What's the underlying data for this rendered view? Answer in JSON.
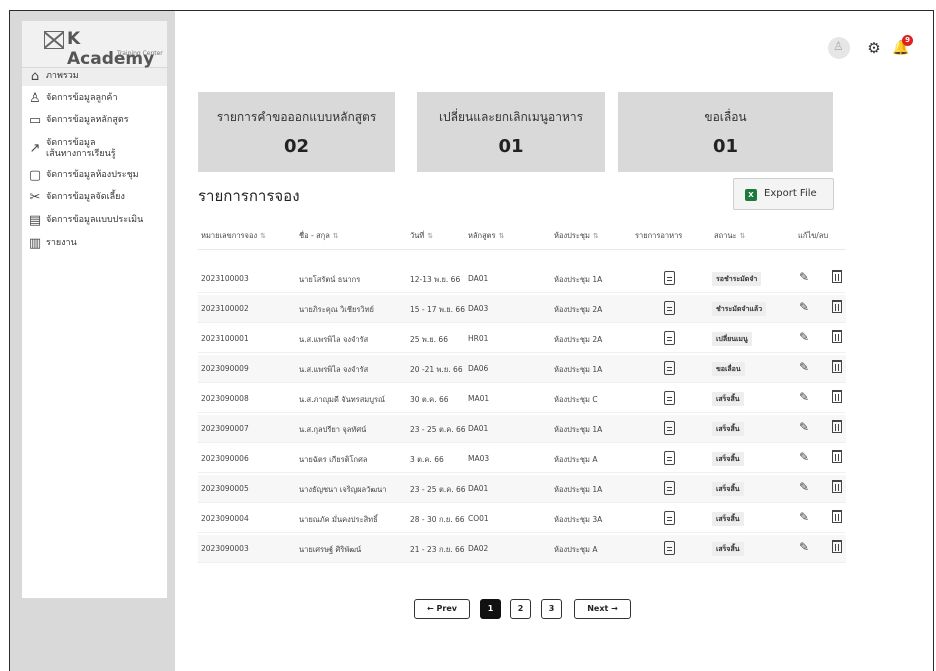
{
  "app": {
    "logo_name": "K Academy",
    "logo_sub": "Training Center"
  },
  "sidebar": {
    "items": [
      {
        "label": "ภาพรวม",
        "icon": "home-icon",
        "glyph": "⌂",
        "active": true
      },
      {
        "label": "จัดการข้อมูลลูกค้า",
        "icon": "user-icon",
        "glyph": "♙"
      },
      {
        "label": "จัดการข้อมูลหลักสูตร",
        "icon": "folder-icon",
        "glyph": "▭"
      },
      {
        "label": "จัดการข้อมูล",
        "label2": "เส้นทางการเรียนรู้",
        "icon": "trend-icon",
        "glyph": "↗"
      },
      {
        "label": "จัดการข้อมูลห้องประชุม",
        "icon": "chat-icon",
        "glyph": "▢"
      },
      {
        "label": "จัดการข้อมูลจัดเลี้ยง",
        "icon": "utensils-icon",
        "glyph": "✂"
      },
      {
        "label": "จัดการข้อมูลแบบประเมิน",
        "icon": "document-icon",
        "glyph": "▤"
      },
      {
        "label": "รายงาน",
        "icon": "report-icon",
        "glyph": "▥"
      }
    ]
  },
  "header": {
    "notification_count": "9",
    "avatar_glyph": "♙",
    "gear_glyph": "⚙",
    "bell_glyph": "🔔"
  },
  "cards": [
    {
      "title": "รายการคำขอออกแบบหลักสูตร",
      "value": "02"
    },
    {
      "title": "เปลี่ยนและยกเลิกเมนูอาหาร",
      "value": "01"
    },
    {
      "title": "ขอเลื่อน",
      "value": "01"
    }
  ],
  "bookings": {
    "title": "รายการการจอง",
    "export_label": "Export File",
    "export_icon_glyph": "X",
    "sort_glyph": "⇅",
    "columns": [
      "หมายเลขการจอง",
      "ชื่อ - สกุล",
      "วันที่",
      "หลักสูตร",
      "ห้องประชุม",
      "รายการอาหาร",
      "สถานะ",
      "แก้ไข/ลบ"
    ],
    "rows": [
      {
        "id": "2023100003",
        "name": "นายโสรัตน์ ธนากร",
        "date": "12-13 พ.ย. 66",
        "course": "DA01",
        "room": "ห้องประชุม 1A",
        "status": "รอชำระมัดจำ"
      },
      {
        "id": "2023100002",
        "name": "นายภิระคุณ วิเชียรวิทย์",
        "date": "15 - 17 พ.ย. 66",
        "course": "DA03",
        "room": "ห้องประชุม 2A",
        "status": "ชำระมัดจำแล้ว"
      },
      {
        "id": "2023100001",
        "name": "น.ส.แพรพิไล จงจำรัส",
        "date": "25 พ.ย. 66",
        "course": "HR01",
        "room": "ห้องประชุม 2A",
        "status": "เปลี่ยนเมนู"
      },
      {
        "id": "2023090009",
        "name": "น.ส.แพรพิไล จงจำรัส",
        "date": "20 -21 พ.ย. 66",
        "course": "DA06",
        "room": "ห้องประชุม 1A",
        "status": "ขอเลื่อน"
      },
      {
        "id": "2023090008",
        "name": "น.ส.ภาญุมดี จันทรสมบูรณ์",
        "date": "30 ต.ค. 66",
        "course": "MA01",
        "room": "ห้องประชุม C",
        "status": "เสร็จสิ้น"
      },
      {
        "id": "2023090007",
        "name": "น.ส.กุลปรียา จุลทัศน์",
        "date": "23 - 25 ต.ค. 66",
        "course": "DA01",
        "room": "ห้องประชุม 1A",
        "status": "เสร็จสิ้น"
      },
      {
        "id": "2023090006",
        "name": "นายฉัตร เกียรติโกศล",
        "date": "3 ต.ค. 66",
        "course": "MA03",
        "room": "ห้องประชุม A",
        "status": "เสร็จสิ้น"
      },
      {
        "id": "2023090005",
        "name": "นางธัญชนา เจริญผลวัฒนา",
        "date": "23 - 25 ต.ค. 66",
        "course": "DA01",
        "room": "ห้องประชุม 1A",
        "status": "เสร็จสิ้น"
      },
      {
        "id": "2023090004",
        "name": "นายณภัค มั่นคงประสิทธิ์",
        "date": "28 - 30 ก.ย. 66",
        "course": "CO01",
        "room": "ห้องประชุม 3A",
        "status": "เสร็จสิ้น"
      },
      {
        "id": "2023090003",
        "name": "นายเศรษฐ์ ศิริพัฒน์",
        "date": "21 - 23 ก.ย. 66",
        "course": "DA02",
        "room": "ห้องประชุม A",
        "status": "เสร็จสิ้น"
      }
    ]
  },
  "pagination": {
    "prev": "← Prev",
    "pages": [
      "1",
      "2",
      "3"
    ],
    "current": "1",
    "next": "Next →"
  }
}
